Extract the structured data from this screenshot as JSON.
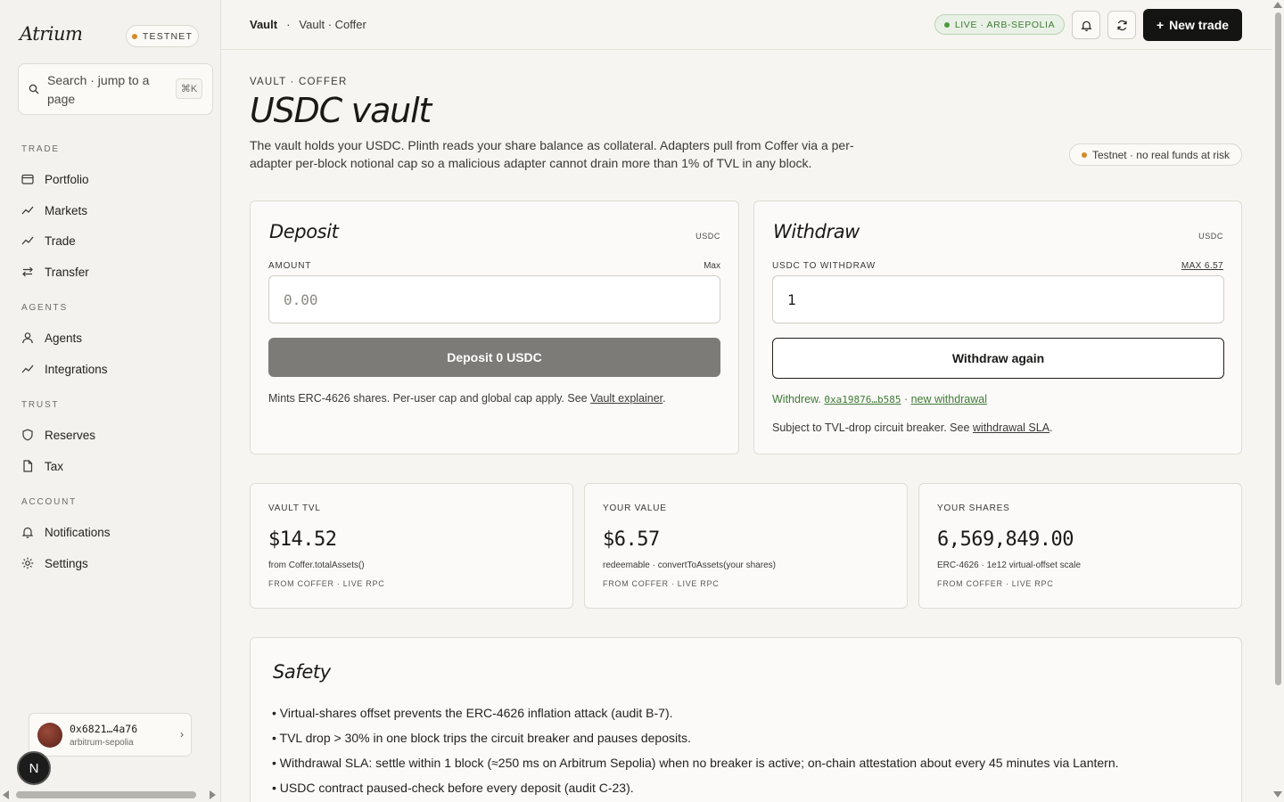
{
  "brand": "Atrium",
  "network_badge": "TESTNET",
  "search": {
    "placeholder": "Search · jump to a page",
    "shortcut": "⌘K"
  },
  "nav": {
    "trade_section": "TRADE",
    "trade_items": [
      "Portfolio",
      "Markets",
      "Trade",
      "Transfer"
    ],
    "agents_section": "AGENTS",
    "agents_items": [
      "Agents",
      "Integrations"
    ],
    "trust_section": "TRUST",
    "trust_items": [
      "Reserves",
      "Tax"
    ],
    "account_section": "ACCOUNT",
    "account_items": [
      "Notifications",
      "Settings"
    ]
  },
  "wallet": {
    "address": "0x6821…4a76",
    "network": "arbitrum-sepolia"
  },
  "avatar_letter": "N",
  "topbar": {
    "breadcrumb_root": "Vault",
    "breadcrumb_sep": "·",
    "breadcrumb_current": "Vault · Coffer",
    "live_label": "LIVE · ARB-SEPOLIA",
    "new_trade_label": "New trade"
  },
  "page": {
    "eyebrow": "VAULT · COFFER",
    "title": "USDC vault",
    "description": "The vault holds your USDC. Plinth reads your share balance as collateral. Adapters pull from Coffer via a per-adapter per-block notional cap so a malicious adapter cannot drain more than 1% of TVL in any block.",
    "testnet_notice": "Testnet · no real funds at risk"
  },
  "deposit": {
    "title": "Deposit",
    "unit": "USDC",
    "amount_label": "AMOUNT",
    "max_label": "Max",
    "placeholder": "0.00",
    "button_label": "Deposit 0 USDC",
    "note_prefix": "Mints ERC-4626 shares. Per-user cap and global cap apply. See ",
    "note_link": "Vault explainer",
    "note_suffix": "."
  },
  "withdraw": {
    "title": "Withdraw",
    "unit": "USDC",
    "amount_label": "USDC TO WITHDRAW",
    "max_label": "MAX 6.57",
    "value": "1",
    "button_label": "Withdraw again",
    "success_prefix": "Withdrew. ",
    "tx_hash": "0xa19876…b585",
    "success_sep": " · ",
    "new_link": "new withdrawal",
    "note_prefix": "Subject to TVL-drop circuit breaker. See ",
    "note_link": "withdrawal SLA",
    "note_suffix": "."
  },
  "stats": [
    {
      "label": "VAULT TVL",
      "value": "$14.52",
      "sub": "from Coffer.totalAssets()",
      "source": "FROM COFFER · LIVE RPC"
    },
    {
      "label": "YOUR VALUE",
      "value": "$6.57",
      "sub": "redeemable · convertToAssets(your shares)",
      "source": "FROM COFFER · LIVE RPC"
    },
    {
      "label": "YOUR SHARES",
      "value": "6,569,849.00",
      "sub": "ERC-4626 · 1e12 virtual-offset scale",
      "source": "FROM COFFER · LIVE RPC"
    }
  ],
  "safety": {
    "title": "Safety",
    "items": [
      "• Virtual-shares offset prevents the ERC-4626 inflation attack (audit B-7).",
      "• TVL drop > 30% in one block trips the circuit breaker and pauses deposits.",
      "• Withdrawal SLA: settle within 1 block (≈250 ms on Arbitrum Sepolia) when no breaker is active; on-chain attestation about every 45 minutes via Lantern.",
      "• USDC contract paused-check before every deposit (audit C-23)."
    ]
  },
  "colors": {
    "accent_green": "#3f7a36",
    "testnet_orange": "#d4892a",
    "primary_dark": "#141413"
  }
}
